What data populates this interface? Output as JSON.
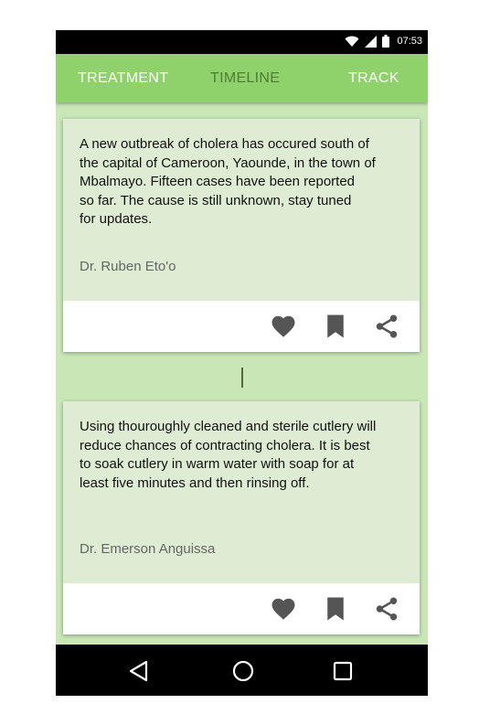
{
  "status_bar": {
    "time": "07:53",
    "icons": [
      "wifi-icon",
      "signal-icon",
      "battery-icon"
    ]
  },
  "tabs": [
    {
      "label": "TREATMENT",
      "active": true
    },
    {
      "label": "TIMELINE",
      "active": false
    },
    {
      "label": "TRACK",
      "active": true
    }
  ],
  "posts": [
    {
      "text": "A new  outbreak of cholera has occured south of\nthe capital of Cameroon, Yaounde, in the town of\nMbalmayo. Fifteen cases have been reported\nso far. The cause is still unknown, stay tuned\nfor updates.",
      "author": "Dr. Ruben Eto'o",
      "actions": [
        "heart-icon",
        "bookmark-icon",
        "share-icon"
      ]
    },
    {
      "text": "Using thouroughly cleaned and sterile cutlery will\nreduce chances of contracting cholera. It is best\nto soak cutlery in warm water with soap for at\nleast five minutes and then rinsing off.",
      "author": "Dr. Emerson Anguissa",
      "actions": [
        "heart-icon",
        "bookmark-icon",
        "share-icon"
      ]
    }
  ],
  "nav": [
    "back-icon",
    "home-icon",
    "recents-icon"
  ],
  "colors": {
    "tab_bar": "#8fd16a",
    "tab_active_text": "#ffffff",
    "tab_inactive_text": "#4c7f37",
    "background": "#c8e6b6",
    "card": "#deecd4",
    "icon": "#555555"
  }
}
